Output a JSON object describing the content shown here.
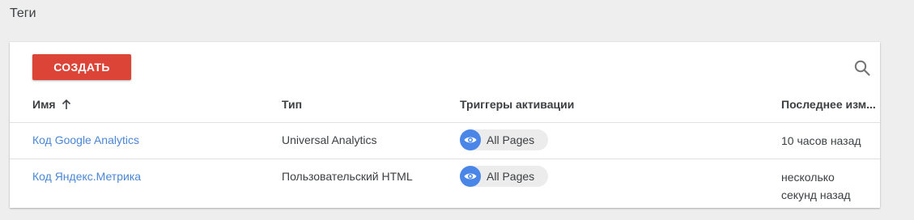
{
  "page": {
    "title": "Теги"
  },
  "toolbar": {
    "create_label": "СОЗДАТЬ",
    "search_icon": "search-icon"
  },
  "table": {
    "columns": {
      "name": "Имя",
      "type": "Тип",
      "triggers": "Триггеры активации",
      "modified": "Последнее изм..."
    },
    "sort": {
      "column": "name",
      "direction": "ascending",
      "icon": "arrow-up-icon"
    },
    "rows": [
      {
        "name": "Код Google Analytics",
        "type": "Universal Analytics",
        "trigger": "All Pages",
        "trigger_icon": "eye-icon",
        "modified_line1": "10 часов назад",
        "modified_line2": ""
      },
      {
        "name": "Код Яндекс.Метрика",
        "type": "Пользовательский HTML",
        "trigger": "All Pages",
        "trigger_icon": "eye-icon",
        "modified_line1": "несколько",
        "modified_line2": "секунд назад"
      }
    ]
  },
  "colors": {
    "accent_button": "#db4437",
    "link": "#4a86d6",
    "trigger_icon_bg": "#4a86e8"
  }
}
